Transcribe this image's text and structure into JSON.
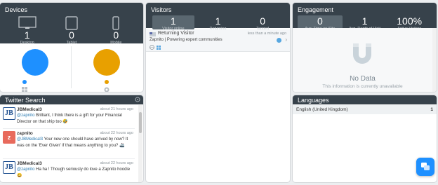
{
  "devices": {
    "title": "Devices",
    "items": [
      {
        "count": "1",
        "label": "Desktop",
        "icon": "desktop-icon"
      },
      {
        "count": "0",
        "label": "Tablet",
        "icon": "tablet-icon"
      },
      {
        "count": "0",
        "label": "Mobile",
        "icon": "mobile-icon"
      }
    ],
    "chart_colors": [
      "#1e90ff",
      "#e8a000"
    ]
  },
  "twitter": {
    "title": "Twitter Search",
    "tweets": [
      {
        "user": "JBMedical3",
        "time": "about 21 hours ago",
        "mention": "@zapnito",
        "text": " Brilliant, I think there is a gift for your Financial Director on that ship too 🤣",
        "avatar": "JB"
      },
      {
        "user": "zapnito",
        "time": "about 22 hours ago",
        "mention": "@JBMedical3",
        "text": " Your new one should have arrived by now? It was on the 'Ever Given' if that means anything to you? 🚢",
        "avatar": "z"
      },
      {
        "user": "JBMedical3",
        "time": "about 22 hours ago",
        "mention": "@zapnito",
        "text": " Ha ha ! Though seriously do love a Zapnito hoodie 😀",
        "avatar": "JB"
      }
    ]
  },
  "visitors": {
    "title": "Visitors",
    "stats": [
      {
        "value": "1",
        "label": "Visitor online"
      },
      {
        "value": "1",
        "label": "Returning"
      },
      {
        "value": "0",
        "label": "Tagged"
      }
    ],
    "entry": {
      "name": "Returning Visitor",
      "time": "less than a minute ago",
      "site": "Zapnito | Powering expert communities"
    }
  },
  "engagement": {
    "title": "Engagement",
    "stats": [
      {
        "value": "0",
        "label": "Avg. Time on Site"
      },
      {
        "value": "1",
        "label": "Avg. Depth of Visit"
      },
      {
        "value": "100%",
        "label": "Active Visitors"
      }
    ],
    "nodata_title": "No Data",
    "nodata_text": "This information is currently unavailable"
  },
  "languages": {
    "title": "Languages",
    "rows": [
      {
        "name": "English (United Kingdom)",
        "count": "1"
      }
    ]
  },
  "chat_button": {
    "icon": "chat-icon",
    "color": "#1e90ff"
  }
}
